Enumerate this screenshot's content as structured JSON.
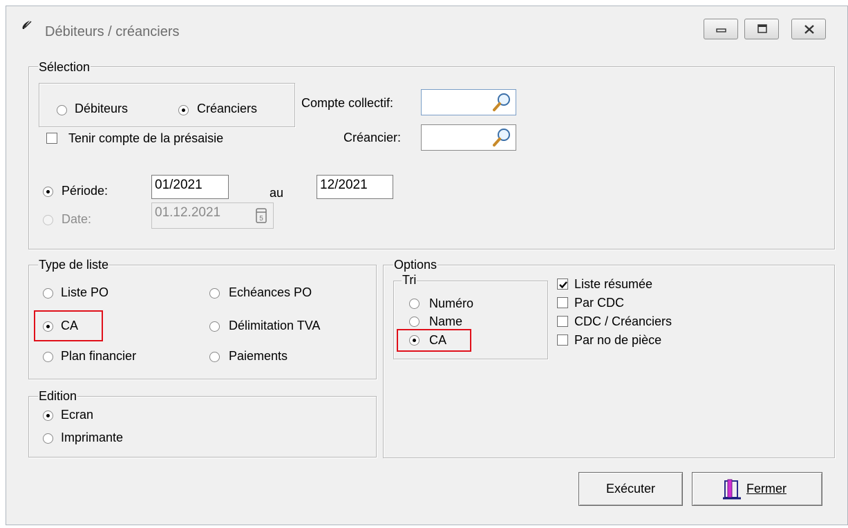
{
  "window": {
    "title": "Débiteurs / créanciers",
    "controls": {
      "minimize": "minimize-icon",
      "restore": "restore-icon",
      "close": "close-icon"
    }
  },
  "selection": {
    "legend": "Sélection",
    "debiteurs_label": "Débiteurs",
    "creanciers_label": "Créanciers",
    "selected": "Créanciers",
    "presaisie_label": "Tenir compte de la présaisie",
    "presaisie_checked": false,
    "compte_collectif_label": "Compte collectif:",
    "compte_collectif_value": "",
    "creancier_label": "Créancier:",
    "creancier_value": "",
    "periode_label": "Période:",
    "periode_from": "01/2021",
    "au_label": "au",
    "periode_to": "12/2021",
    "date_label": "Date:",
    "date_value": "01.12.2021",
    "period_mode": "Période"
  },
  "type_liste": {
    "legend": "Type de liste",
    "options": [
      "Liste PO",
      "Echéances PO",
      "CA",
      "Délimitation TVA",
      "Plan financier",
      "Paiements"
    ],
    "selected": "CA"
  },
  "edition": {
    "legend": "Edition",
    "options": [
      "Ecran",
      "Imprimante"
    ],
    "selected": "Ecran"
  },
  "options": {
    "legend": "Options",
    "tri_legend": "Tri",
    "tri_options": [
      "Numéro",
      "Name",
      "CA"
    ],
    "tri_selected": "CA",
    "checkboxes": [
      {
        "label": "Liste résumée",
        "checked": true
      },
      {
        "label": "Par CDC",
        "checked": false
      },
      {
        "label": "CDC / Créanciers",
        "checked": false
      },
      {
        "label": "Par no de pièce",
        "checked": false
      }
    ]
  },
  "buttons": {
    "execute_label": "Exécuter",
    "close_label": "Fermer"
  },
  "colors": {
    "highlight": "#e0101a",
    "window_bg": "#f0f0f0"
  }
}
